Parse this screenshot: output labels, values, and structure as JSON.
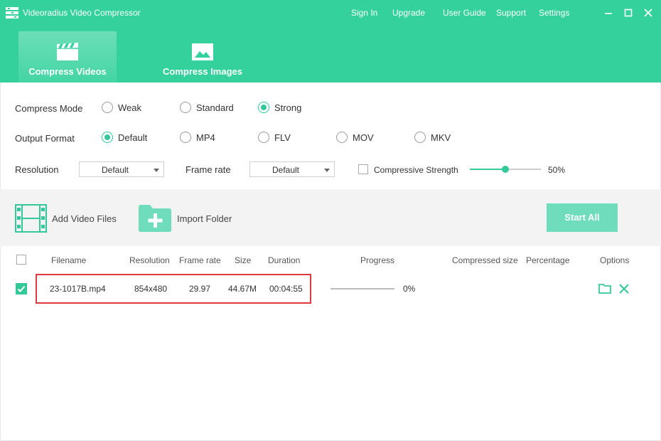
{
  "app": {
    "title": "Videoradius Video Compressor"
  },
  "topmenu": [
    "Sign In",
    "Upgrade",
    "User Guide",
    "Support",
    "Settings"
  ],
  "tabs": [
    {
      "label": "Compress Videos",
      "icon": "clapperboard-icon",
      "active": true
    },
    {
      "label": "Compress Images",
      "icon": "image-icon",
      "active": false
    }
  ],
  "settings": {
    "compress_mode": {
      "label": "Compress Mode",
      "options": [
        "Weak",
        "Standard",
        "Strong"
      ],
      "selected": "Strong"
    },
    "output_format": {
      "label": "Output Format",
      "options": [
        "Default",
        "MP4",
        "FLV",
        "MOV",
        "MKV"
      ],
      "selected": "Default"
    },
    "resolution": {
      "label": "Resolution",
      "value": "Default"
    },
    "frame_rate": {
      "label": "Frame rate",
      "value": "Default"
    },
    "compressive_strength": {
      "label": "Compressive Strength",
      "checked": false,
      "value_text": "50%",
      "value": 0.5
    }
  },
  "toolbar": {
    "add_files": "Add Video Files",
    "import_folder": "Import Folder",
    "start_all": "Start All"
  },
  "table": {
    "headers": [
      "Filename",
      "Resolution",
      "Frame rate",
      "Size",
      "Duration",
      "Progress",
      "Compressed size",
      "Percentage",
      "Options"
    ],
    "rows": [
      {
        "checked": true,
        "filename": "23-1017B.mp4",
        "resolution": "854x480",
        "frame_rate": "29.97",
        "size": "44.67M",
        "duration": "00:04:55",
        "progress_text": "0%",
        "progress": 0,
        "compressed_size": "",
        "percentage": ""
      }
    ]
  },
  "colors": {
    "accent": "#34d19d",
    "button": "#6fdcbc",
    "highlight": "#e0393e"
  }
}
